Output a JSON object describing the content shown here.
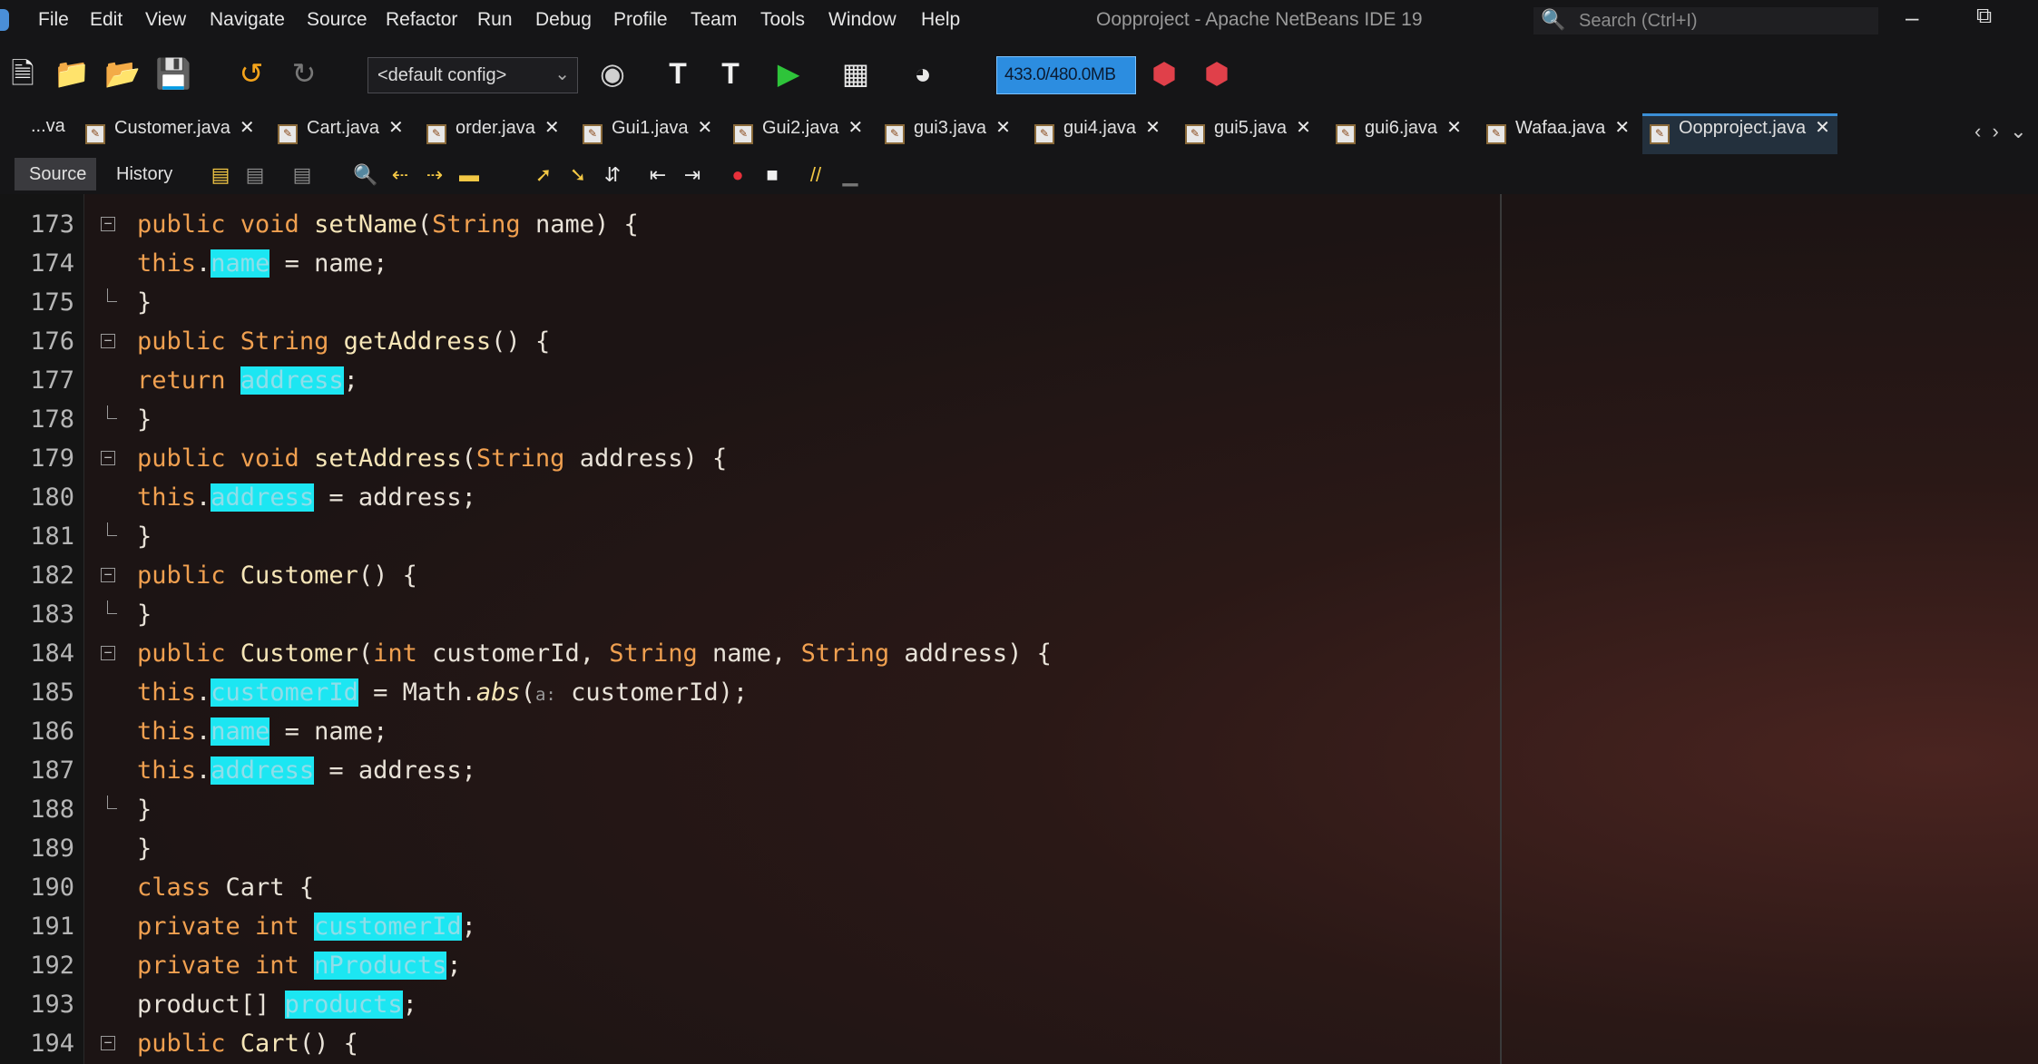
{
  "menu": [
    "File",
    "Edit",
    "View",
    "Navigate",
    "Source",
    "Refactor",
    "Run",
    "Debug",
    "Profile",
    "Team",
    "Tools",
    "Window",
    "Help"
  ],
  "window_title": "Oopproject - Apache NetBeans IDE 19",
  "search_placeholder": "Search (Ctrl+I)",
  "toolbar": {
    "config_label": "<default config>",
    "memory_label": "433.0/480.0MB"
  },
  "tabs": [
    {
      "label": "...va",
      "has_close": false
    },
    {
      "label": "Customer.java"
    },
    {
      "label": "Cart.java"
    },
    {
      "label": "order.java"
    },
    {
      "label": "Gui1.java"
    },
    {
      "label": "Gui2.java"
    },
    {
      "label": "gui3.java"
    },
    {
      "label": "gui4.java"
    },
    {
      "label": "gui5.java"
    },
    {
      "label": "gui6.java"
    },
    {
      "label": "Wafaa.java"
    },
    {
      "label": "Oopproject.java",
      "active": true
    }
  ],
  "editor_tabs": {
    "source": "Source",
    "history": "History"
  },
  "code_lines": [
    {
      "n": "173",
      "text": "public void setName(String name) {"
    },
    {
      "n": "174",
      "text": "this.name = name;"
    },
    {
      "n": "175",
      "text": "}"
    },
    {
      "n": "176",
      "text": "public String getAddress() {"
    },
    {
      "n": "177",
      "text": "return address;"
    },
    {
      "n": "178",
      "text": "}"
    },
    {
      "n": "179",
      "text": "public void setAddress(String address) {"
    },
    {
      "n": "180",
      "text": "this.address = address;"
    },
    {
      "n": "181",
      "text": "}"
    },
    {
      "n": "182",
      "text": "public Customer() {"
    },
    {
      "n": "183",
      "text": "}"
    },
    {
      "n": "184",
      "text": "public Customer(int customerId, String name, String address) {"
    },
    {
      "n": "185",
      "text": "this.customerId = Math.abs(a: customerId);"
    },
    {
      "n": "186",
      "text": "this.name = name;"
    },
    {
      "n": "187",
      "text": "this.address = address;"
    },
    {
      "n": "188",
      "text": "}"
    },
    {
      "n": "189",
      "text": "}"
    },
    {
      "n": "190",
      "text": "class Cart {"
    },
    {
      "n": "191",
      "text": "private int customerId;"
    },
    {
      "n": "192",
      "text": "private int nProducts;"
    },
    {
      "n": "193",
      "text": "product[] products;"
    },
    {
      "n": "194",
      "text": "public Cart() {"
    }
  ],
  "colors": {
    "keyword": "#f0a050",
    "highlight": "#1ce6f2",
    "memory_bar": "#2c8de0",
    "active_tab": "#3b8fd6"
  },
  "icons": [
    "netbeans-logo-icon",
    "new-project-icon",
    "new-file-icon",
    "open-project-icon",
    "save-all-icon",
    "undo-icon",
    "redo-icon",
    "globe-icon",
    "build-icon",
    "clean-build-icon",
    "run-icon",
    "debug-icon",
    "profile-icon",
    "gc-icon",
    "gc-alt-icon",
    "search-icon"
  ]
}
